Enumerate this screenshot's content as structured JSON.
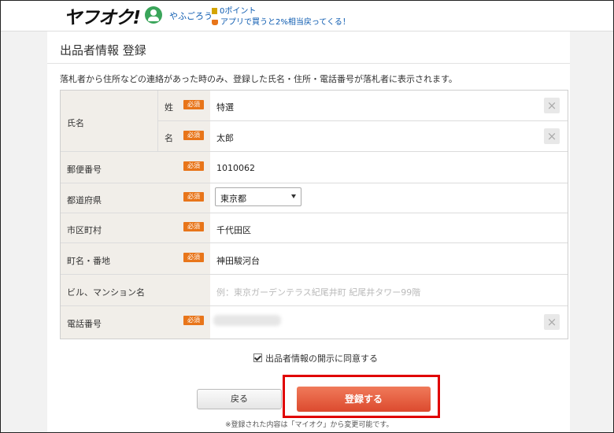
{
  "header": {
    "logo": "ヤフオク!",
    "username": "やふごろう",
    "points": "0ポイント",
    "promo": "アプリで買うと2%相当戻ってくる！"
  },
  "page": {
    "title": "出品者情報 登録",
    "notice": "落札者から住所などの連絡があった時のみ、登録した氏名・住所・電話番号が落札者に表示されます。"
  },
  "form": {
    "required_label": "必須",
    "name_label": "氏名",
    "last_name_label": "姓",
    "last_name_value": "特選",
    "first_name_label": "名",
    "first_name_value": "太郎",
    "postal_label": "郵便番号",
    "postal_value": "1010062",
    "prefecture_label": "都道府県",
    "prefecture_value": "東京都",
    "city_label": "市区町村",
    "city_value": "千代田区",
    "town_label": "町名・番地",
    "town_value": "神田駿河台",
    "building_label": "ビル、マンション名",
    "building_placeholder": "例：東京ガーデンテラス紀尾井町 紀尾井タワー99階",
    "phone_label": "電話番号",
    "clear_glyph": "×"
  },
  "agree": {
    "label": "出品者情報の開示に同意する",
    "checked": true
  },
  "buttons": {
    "back": "戻る",
    "register": "登録する"
  },
  "footnote": "※登録された内容は「マイオク」から変更可能です。",
  "colors": {
    "required_badge": "#e8751a",
    "register_button": "#e05a3a",
    "highlight_border": "#e00000",
    "label_bg": "#f1eee9"
  }
}
